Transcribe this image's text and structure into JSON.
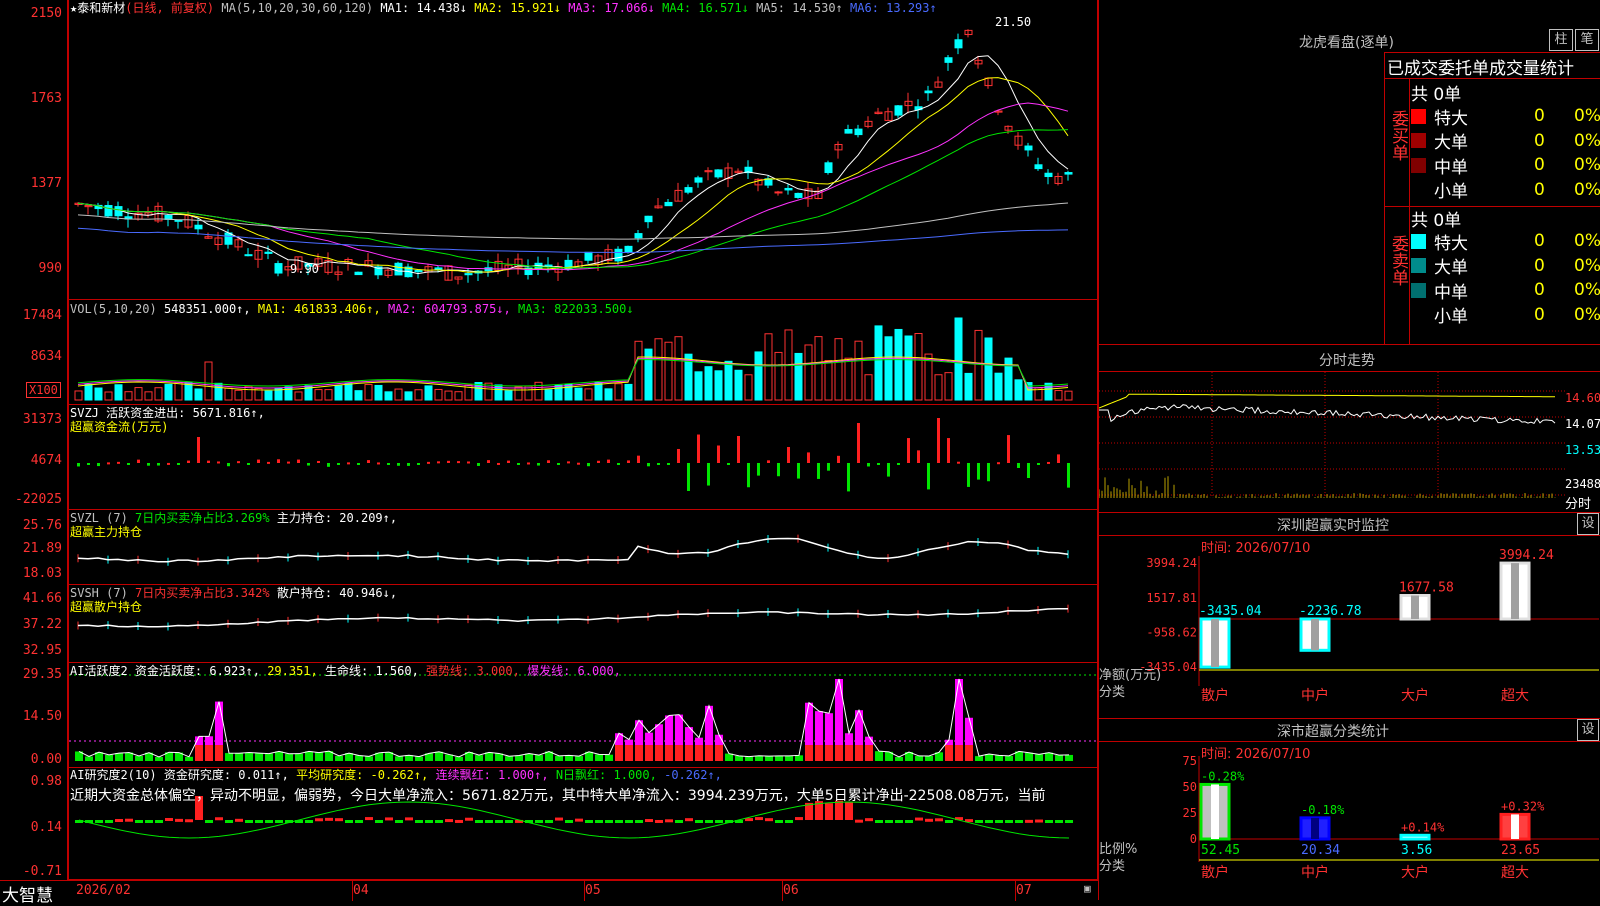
{
  "main_chart": {
    "title": "★泰和新材",
    "mode": "(日线, 前复权)",
    "ma_label": "MA(5,10,20,30,60,120)",
    "ma": [
      {
        "label": "MA1: 14.438↓",
        "color": "#ffffff"
      },
      {
        "label": "MA2: 15.921↓",
        "color": "#ffff00"
      },
      {
        "label": "MA3: 17.066↓",
        "color": "#ff32ff"
      },
      {
        "label": "MA4: 16.571↓",
        "color": "#00e600"
      },
      {
        "label": "MA5: 14.530↑",
        "color": "#c0c0c0"
      },
      {
        "label": "MA6: 13.293↑",
        "color": "#4a6bff"
      }
    ],
    "y_ticks": [
      "2150",
      "1763",
      "1377",
      "990"
    ],
    "high_label": "21.50",
    "low_label": "9.90"
  },
  "vol": {
    "legend_prefix": "VOL(5,10,20)",
    "value": "548351.000↑,",
    "ma1": "MA1: 461833.406↑,",
    "ma2": "MA2: 604793.875↓,",
    "ma3": "MA3: 822033.500↓",
    "y_ticks": [
      "17484",
      "8634"
    ],
    "unit": "X100"
  },
  "svzj": {
    "legend": "SVZJ  活跃资金进出: 5671.816↑,",
    "subtitle": "超赢资金流(万元)",
    "y_ticks": [
      "31373",
      "4674",
      "-22025"
    ]
  },
  "svzl": {
    "legend_prefix": "SVZL (7)",
    "legend_red": "7日内买卖净占比3.269%",
    "legend_rest": "主力持仓: 20.209↑,",
    "subtitle": "超赢主力持仓",
    "y_ticks": [
      "25.76",
      "21.89",
      "18.03"
    ]
  },
  "svsh": {
    "legend_prefix": "SVSH (7)",
    "legend_red": "7日内买卖净占比3.342%",
    "legend_rest": "散户持仓: 40.946↓,",
    "subtitle": "超赢散户持仓",
    "y_ticks": [
      "41.66",
      "37.22",
      "32.95"
    ]
  },
  "ai_active": {
    "legend_prefix": "AI活跃度2",
    "item1": "资金活跃度: 6.923↑,",
    "item2": "29.351,",
    "item3": "生命线: 1.560,",
    "item4": "强势线: 3.000,",
    "item5": "爆发线: 6.000,",
    "y_ticks": [
      "29.35",
      "14.50",
      "0.00"
    ]
  },
  "ai_research": {
    "legend_prefix": "AI研究度2(10)",
    "item1": "资金研究度: 0.011↑,",
    "item2": "平均研究度: -0.262↑,",
    "item3": "连续飘红: 1.000↑,",
    "item4": "N日飘红: 1.000,",
    "item5": "-0.262↑,",
    "comment": "近期大资金总体偏空，异动不明显，偏弱势，今日大单净流入：5671.82万元，其中特大单净流入：3994.239万元，大单5日累计净出-22508.08万元，当前",
    "y_ticks": [
      "0.98",
      "0.14",
      "-0.71"
    ]
  },
  "footer": {
    "brand": "大智慧",
    "dates": [
      "2026/02",
      "04",
      "05",
      "06",
      "07"
    ]
  },
  "dragon_tiger": {
    "title": "龙虎看盘(逐单)",
    "btn1": "柱",
    "btn2": "笔",
    "tabs": "已成交委托单成交量统计",
    "buy_label": "委买单",
    "sell_label": "委卖单",
    "buy_total": "共 0单",
    "sell_total": "共 0单",
    "buy_rows": [
      {
        "name": "特大",
        "count": "0",
        "pct": "0%",
        "color": "#ff0000"
      },
      {
        "name": "大单",
        "count": "0",
        "pct": "0%",
        "color": "#a00000"
      },
      {
        "name": "中单",
        "count": "0",
        "pct": "0%",
        "color": "#800000"
      },
      {
        "name": "小单",
        "count": "0",
        "pct": "0%",
        "color": ""
      }
    ],
    "sell_rows": [
      {
        "name": "特大",
        "count": "0",
        "pct": "0%",
        "color": "#00ffff"
      },
      {
        "name": "大单",
        "count": "0",
        "pct": "0%",
        "color": "#008c8c"
      },
      {
        "name": "中单",
        "count": "0",
        "pct": "0%",
        "color": "#007070"
      },
      {
        "name": "小单",
        "count": "0",
        "pct": "0%",
        "color": ""
      }
    ]
  },
  "intraday": {
    "title": "分时走势",
    "y_ticks": [
      "14.60",
      "14.07",
      "13.53"
    ],
    "vol_tick": "23488",
    "vol_unit": "分时"
  },
  "sz_monitor": {
    "title": "深圳超赢实时监控",
    "btn": "设",
    "time": "时间: 2026/07/10",
    "y_ticks": [
      "3994.24",
      "1517.81",
      "-958.62",
      "-3435.04"
    ],
    "axis_label1": "净额(万元)",
    "axis_label2": "分类",
    "categories": [
      "散户",
      "中户",
      "大户",
      "超大"
    ],
    "values": [
      -3435.04,
      -2236.78,
      1677.58,
      3994.24
    ],
    "value_labels": [
      "-3435.04",
      "-2236.78",
      "1677.58",
      "3994.24"
    ]
  },
  "sz_class": {
    "title": "深市超赢分类统计",
    "btn": "设",
    "time": "时间: 2026/07/10",
    "y_ticks": [
      "75",
      "50",
      "25",
      "0"
    ],
    "axis_label1": "比例%",
    "axis_label2": "分类",
    "categories": [
      "散户",
      "中户",
      "大户",
      "超大"
    ],
    "values": [
      52.45,
      20.34,
      3.56,
      23.65
    ],
    "changes": [
      "-0.28%",
      "-0.18%",
      "+0.14%",
      "+0.32%"
    ]
  }
}
